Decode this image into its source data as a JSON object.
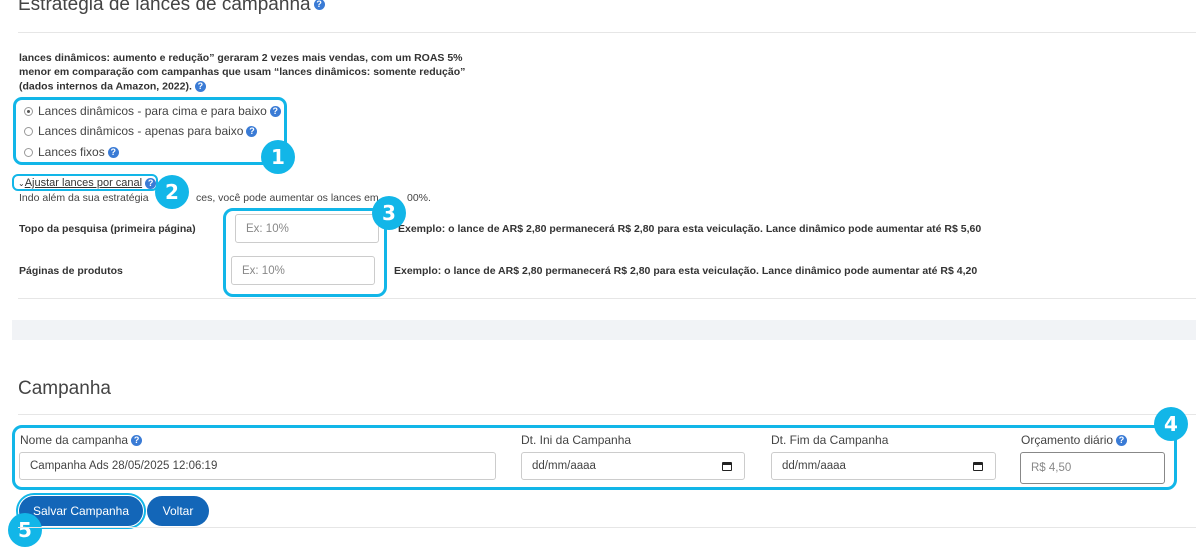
{
  "bidding": {
    "title": "Estratégia de lances de campanha",
    "info_line1": "lances dinâmicos: aumento e redução” geraram 2 vezes mais vendas, com um ROAS 5%",
    "info_line2": "menor em comparação com campanhas que usam “lances dinâmicos: somente redução”",
    "info_line3": "(dados internos da Amazon, 2022).",
    "options": [
      {
        "label": "Lances dinâmicos - para cima e para baixo",
        "checked": true
      },
      {
        "label": "Lances dinâmicos - apenas para baixo",
        "checked": false
      },
      {
        "label": "Lances fixos",
        "checked": false
      }
    ],
    "adjust_link": "Ajustar lances por canal",
    "adjust_desc_a": "Indo além da sua estratégia",
    "adjust_desc_b": "ces, você pode aumentar os lances em",
    "adjust_desc_c": "00%.",
    "placements": [
      {
        "label": "Topo da pesquisa (primeira página)",
        "placeholder": "Ex: 10%",
        "example": "Exemplo: o lance de AR$ 2,80 permanecerá R$ 2,80 para esta veiculação. Lance dinâmico pode aumentar até R$ 5,60"
      },
      {
        "label": "Páginas de produtos",
        "placeholder": "Ex: 10%",
        "example": "Exemplo: o lance de AR$ 2,80 permanecerá R$ 2,80 para esta veiculação. Lance dinâmico pode aumentar até R$ 4,20"
      }
    ]
  },
  "campaign": {
    "title": "Campanha",
    "name_label": "Nome da campanha",
    "name_value": "Campanha Ads 28/05/2025 12:06:19",
    "start_label": "Dt. Ini da Campanha",
    "start_value": "dd/mm/aaaa",
    "end_label": "Dt. Fim da Campanha",
    "end_value": "dd/mm/aaaa",
    "budget_label": "Orçamento diário",
    "budget_placeholder": "R$ 4,50",
    "save_button": "Salvar Campanha",
    "back_button": "Voltar"
  },
  "badges": [
    "1",
    "2",
    "3",
    "4",
    "5"
  ],
  "colors": {
    "highlight": "#12b6e8",
    "primary_button": "#1366b8",
    "help_icon": "#3a7bd5"
  }
}
